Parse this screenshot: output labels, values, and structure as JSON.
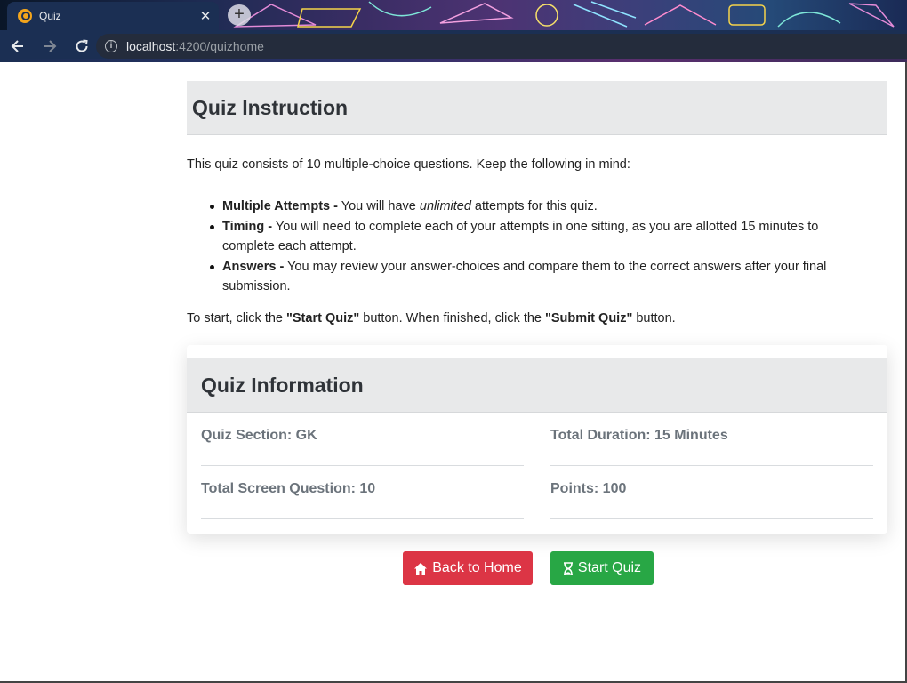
{
  "browser": {
    "tab_title": "Quiz",
    "tab_close": "✕",
    "new_tab": "+",
    "url_host": "localhost",
    "url_path": ":4200/quizhome"
  },
  "instructions": {
    "heading": "Quiz Instruction",
    "intro": "This quiz consists of 10 multiple-choice questions. Keep the following in mind:",
    "rules": [
      {
        "label": "Multiple Attempts -",
        "pre": " You will have ",
        "em": "unlimited",
        "post": " attempts for this quiz."
      },
      {
        "label": "Timing -",
        "text": " You will need to complete each of your attempts in one sitting, as you are allotted 15 minutes to complete each attempt."
      },
      {
        "label": "Answers -",
        "text": " You may review your answer-choices and compare them to the correct answers after your final submission."
      }
    ],
    "outro_1": "To start, click the ",
    "outro_b1": "\"Start Quiz\"",
    "outro_2": " button. When finished, click the ",
    "outro_b2": "\"Submit Quiz\"",
    "outro_3": " button."
  },
  "info": {
    "heading": "Quiz Information",
    "section": "Quiz Section: GK",
    "duration": "Total Duration: 15 Minutes",
    "questions": "Total Screen Question: 10",
    "points": "Points: 100"
  },
  "buttons": {
    "home_label": "Back to Home",
    "start_label": "Start Quiz"
  },
  "colors": {
    "danger": "#dc3545",
    "success": "#28a745",
    "chrome": "#1b2f53"
  }
}
